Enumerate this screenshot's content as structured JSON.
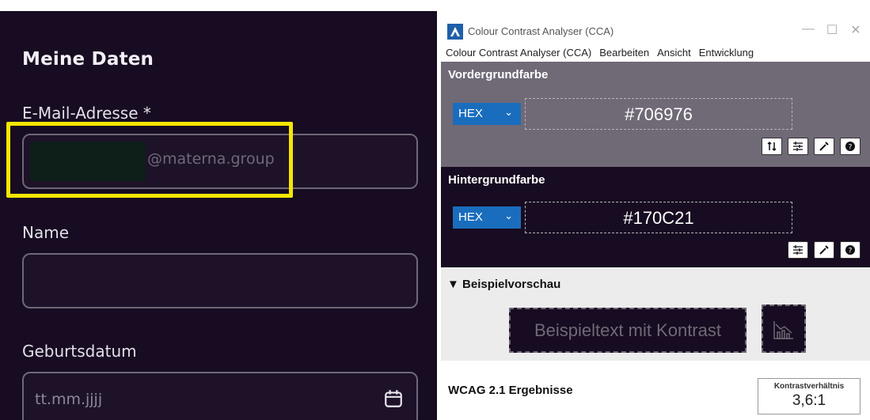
{
  "form": {
    "heading": "Meine Daten",
    "email_label": "E-Mail-Adresse *",
    "email_domain": "@materna.group",
    "name_label": "Name",
    "name_value": "",
    "birthdate_label": "Geburtsdatum",
    "birthdate_placeholder": "tt.mm.jjjj",
    "highlight_color": "#f5e600"
  },
  "cca": {
    "title": "Colour Contrast Analyser (CCA)",
    "menu": [
      "Colour Contrast Analyser (CCA)",
      "Bearbeiten",
      "Ansicht",
      "Entwicklung"
    ],
    "foreground": {
      "title": "Vordergrundfarbe",
      "format": "HEX",
      "value": "#706976",
      "tools": [
        "swap-icon",
        "sliders-icon",
        "eyedropper-icon",
        "help-icon"
      ]
    },
    "background": {
      "title": "Hintergrundfarbe",
      "format": "HEX",
      "value": "#170C21",
      "tools": [
        "sliders-icon",
        "eyedropper-icon",
        "help-icon"
      ]
    },
    "preview": {
      "title": "▼ Beispielvorschau",
      "sample_text": "Beispieltext mit Kontrast"
    },
    "results": {
      "title": "WCAG 2.1 Ergebnisse",
      "ratio_label": "Kontrastverhältnis",
      "ratio_value": "3,6:1"
    }
  }
}
